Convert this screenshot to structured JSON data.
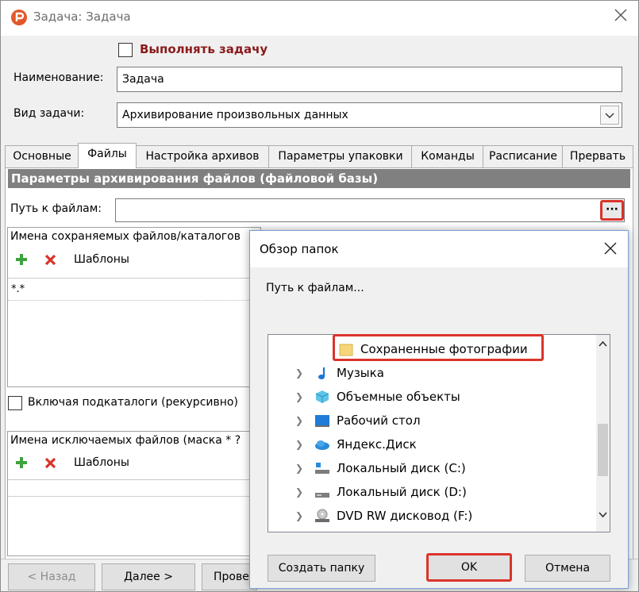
{
  "window": {
    "title": "Задача: Задача"
  },
  "form": {
    "execute_label": "Выполнять задачу",
    "name_label": "Наименование:",
    "name_value": "Задача",
    "type_label": "Вид задачи:",
    "type_value": "Архивирование произвольных данных"
  },
  "tabs": [
    "Основные",
    "Файлы",
    "Настройка архивов",
    "Параметры упаковки",
    "Команды",
    "Расписание",
    "Прервать"
  ],
  "files_panel": {
    "header": "Параметры архивирования файлов (файловой базы)",
    "path_label": "Путь к файлам:",
    "path_value": "",
    "browse_label": "···",
    "included_label": "Имена сохраняемых файлов/каталогов",
    "templates_label": "Шаблоны",
    "include_value": "*.*",
    "recursive_label": "Включая подкаталоги (рекурсивно)",
    "excluded_label": "Имена исключаемых файлов  (маска * ?",
    "templates2_label": "Шаблоны"
  },
  "bottom_buttons": {
    "back": "< Назад",
    "next": "Далее >",
    "check": "Прове"
  },
  "dialog": {
    "title": "Обзор папок",
    "prompt": "Путь к файлам...",
    "tree": [
      {
        "label": "Сохраненные фотографии",
        "icon": "folder-icon",
        "selected": true
      },
      {
        "label": "Музыка",
        "icon": "music-icon"
      },
      {
        "label": "Объемные объекты",
        "icon": "3d-objects-icon"
      },
      {
        "label": "Рабочий стол",
        "icon": "desktop-icon"
      },
      {
        "label": "Яндекс.Диск",
        "icon": "cloud-icon"
      },
      {
        "label": "Локальный диск (C:)",
        "icon": "system-drive-icon"
      },
      {
        "label": "Локальный диск (D:)",
        "icon": "drive-icon"
      },
      {
        "label": "DVD RW дисковод (F:)",
        "icon": "dvd-drive-icon"
      }
    ],
    "new_folder": "Создать папку",
    "ok": "OK",
    "cancel": "Отмена"
  },
  "colors": {
    "accent_red": "#d9342b",
    "title_red": "#8b1a1a",
    "header_gray": "#808080"
  }
}
